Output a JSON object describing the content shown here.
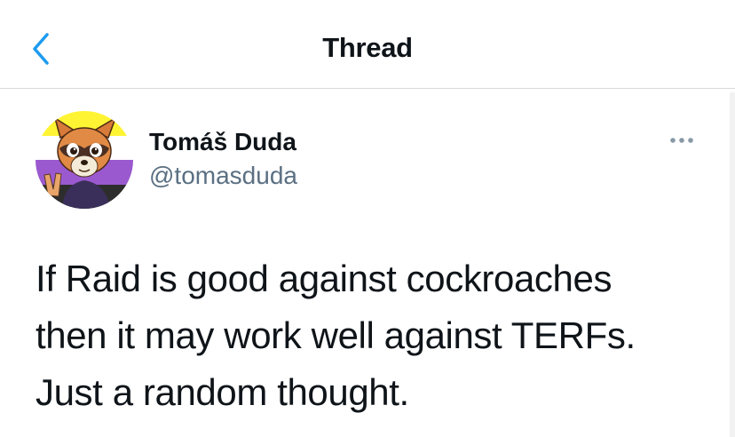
{
  "header": {
    "title": "Thread",
    "back_icon": "chevron-left-icon",
    "accent_color": "#1d9bf0"
  },
  "tweet": {
    "display_name": "Tomáš Duda",
    "handle": "@tomasduda",
    "more_icon": "more-horizontal-icon",
    "text_lines": [
      "If Raid is good against cockroaches",
      "then it may work well against TERFs.",
      "Just a random thought."
    ]
  },
  "colors": {
    "text": "#0f1419",
    "secondary_text": "#5b7083",
    "avatar_flag": [
      "#fff433",
      "#ffffff",
      "#9b59d0",
      "#2d2d2d"
    ]
  }
}
